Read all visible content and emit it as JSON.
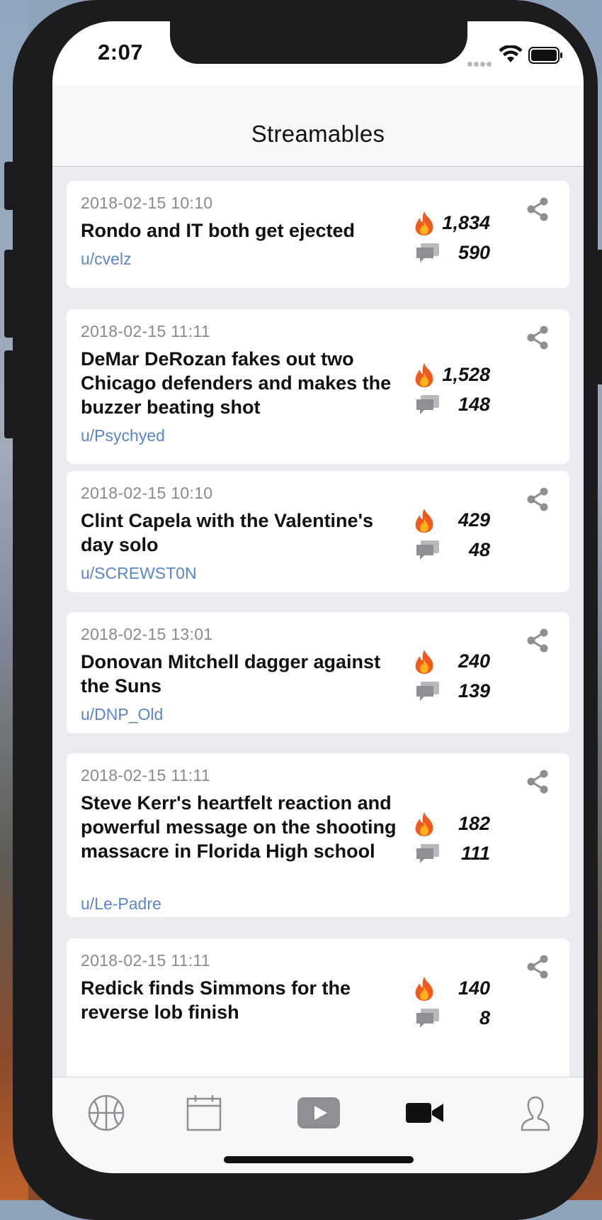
{
  "status_bar": {
    "time": "2:07"
  },
  "nav": {
    "title": "Streamables"
  },
  "posts": [
    {
      "date": "2018-02-15 10:10",
      "title": "Rondo and IT both get ejected",
      "user": "u/cvelz",
      "score": "1,834",
      "comments": "590"
    },
    {
      "date": "2018-02-15 11:11",
      "title": "DeMar DeRozan fakes out two Chicago defenders and makes the buzzer beating shot",
      "user": "u/Psychyed",
      "score": "1,528",
      "comments": "148"
    },
    {
      "date": "2018-02-15 10:10",
      "title": "Clint Capela with the Valentine's day solo",
      "user": "u/SCREWST0N",
      "score": "429",
      "comments": "48"
    },
    {
      "date": "2018-02-15 13:01",
      "title": "Donovan Mitchell dagger against the Suns",
      "user": "u/DNP_Old",
      "score": "240",
      "comments": "139"
    },
    {
      "date": "2018-02-15 11:11",
      "title": "Steve Kerr's heartfelt reaction and powerful message on the shooting massacre in Florida High school",
      "user": "u/Le-Padre",
      "score": "182",
      "comments": "111"
    },
    {
      "date": "2018-02-15 11:11",
      "title": "Redick finds Simmons for the reverse lob finish",
      "user": "",
      "score": "140",
      "comments": "8"
    }
  ],
  "tabs": [
    {
      "icon": "basketball-icon",
      "active": false
    },
    {
      "icon": "calendar-icon",
      "active": false
    },
    {
      "icon": "play-icon",
      "active": false
    },
    {
      "icon": "video-camera-icon",
      "active": true
    },
    {
      "icon": "profile-icon",
      "active": false
    }
  ],
  "colors": {
    "accent_link": "#5a86c8",
    "feed_bg": "#ebebf0",
    "tab_active": "#111111",
    "tab_inactive": "#8e8e93"
  }
}
